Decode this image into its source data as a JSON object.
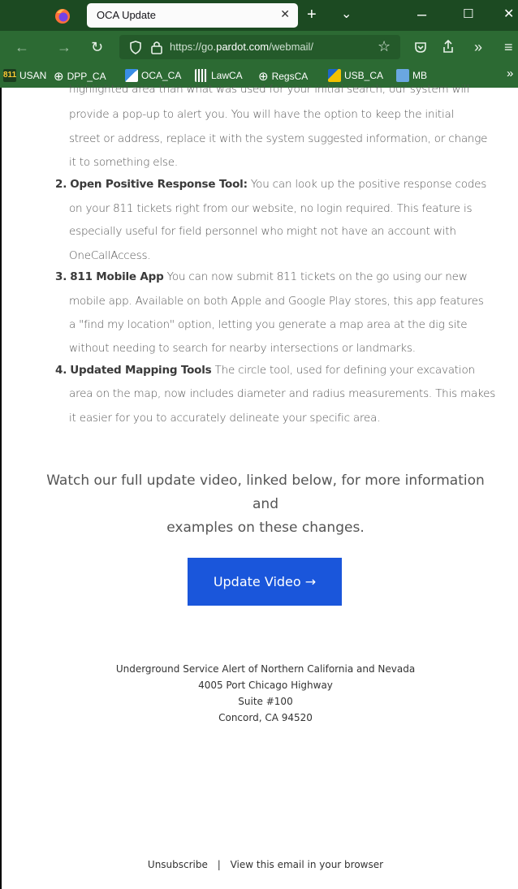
{
  "browser": {
    "tab_title": "OCA Update",
    "url_prefix": "https://go.",
    "url_domain": "pardot.com",
    "url_suffix": "/webmail/",
    "icons": {
      "app": "firefox-logo-icon",
      "close": "close-icon",
      "new_tab": "plus-icon",
      "list_tabs": "chevron-down-icon",
      "minimize": "minimize-icon",
      "maximize": "maximize-icon",
      "window_close": "window-close-icon",
      "back": "back-arrow-icon",
      "forward": "forward-arrow-icon",
      "reload": "reload-icon",
      "shield": "shield-icon",
      "lock": "lock-icon",
      "star": "star-icon",
      "pocket": "pocket-icon",
      "share": "share-icon",
      "overflow": "double-chevron-icon",
      "menu": "hamburger-menu-icon"
    }
  },
  "bookmarks": [
    {
      "label": "USAN",
      "icon": "811-icon"
    },
    {
      "label": "DPP_CA",
      "icon": "globe-icon"
    },
    {
      "label": "OCA_CA",
      "icon": "oca-icon"
    },
    {
      "label": "LawCA",
      "icon": "law-icon"
    },
    {
      "label": "RegsCA",
      "icon": "globe-icon"
    },
    {
      "label": "USB_CA",
      "icon": "usb-icon"
    },
    {
      "label": "MB",
      "icon": "mb-icon"
    }
  ],
  "content": {
    "item1_lines": [
      "highlighted area than what was used for your initial search, our system will",
      "provide a pop-up to alert you. You will have the option to keep the initial",
      "street or address, replace it with the system suggested information, or change",
      "it to something else."
    ],
    "item2_num": "2.",
    "item2_title": "Open Positive Response Tool:",
    "item2_lines": [
      " You can look up the positive response codes",
      "on your 811 tickets right from our website, no login required. This feature is",
      "especially useful for field personnel who might not have an account with",
      "OneCallAccess."
    ],
    "item3_num": "3.",
    "item3_title": "811 Mobile App",
    "item3_lines": [
      " You can now submit 811 tickets on the go using our new",
      "mobile app. Available on both Apple and Google Play stores, this app features",
      "a \"find my location\" option, letting you generate a map area at the dig site",
      "without needing to search for nearby intersections or landmarks."
    ],
    "item4_num": "4.",
    "item4_title": "Updated Mapping Tools",
    "item4_lines": [
      " The circle tool, used for defining your excavation",
      "area on the map, now includes diameter and radius measurements. This makes",
      "it easier for you to accurately delineate your specific area."
    ],
    "watch_line1": "Watch our full update video, linked below, for more information and",
    "watch_line2": "examples on these changes.",
    "cta_label": "Update Video →"
  },
  "footer": {
    "org": "Underground Service Alert of Northern California and Nevada",
    "street": "4005 Port Chicago Highway",
    "suite": "Suite #100",
    "city": "Concord, CA 94520",
    "unsubscribe": "Unsubscribe",
    "separator": "|",
    "view_in_browser": "View this email in your browser"
  }
}
